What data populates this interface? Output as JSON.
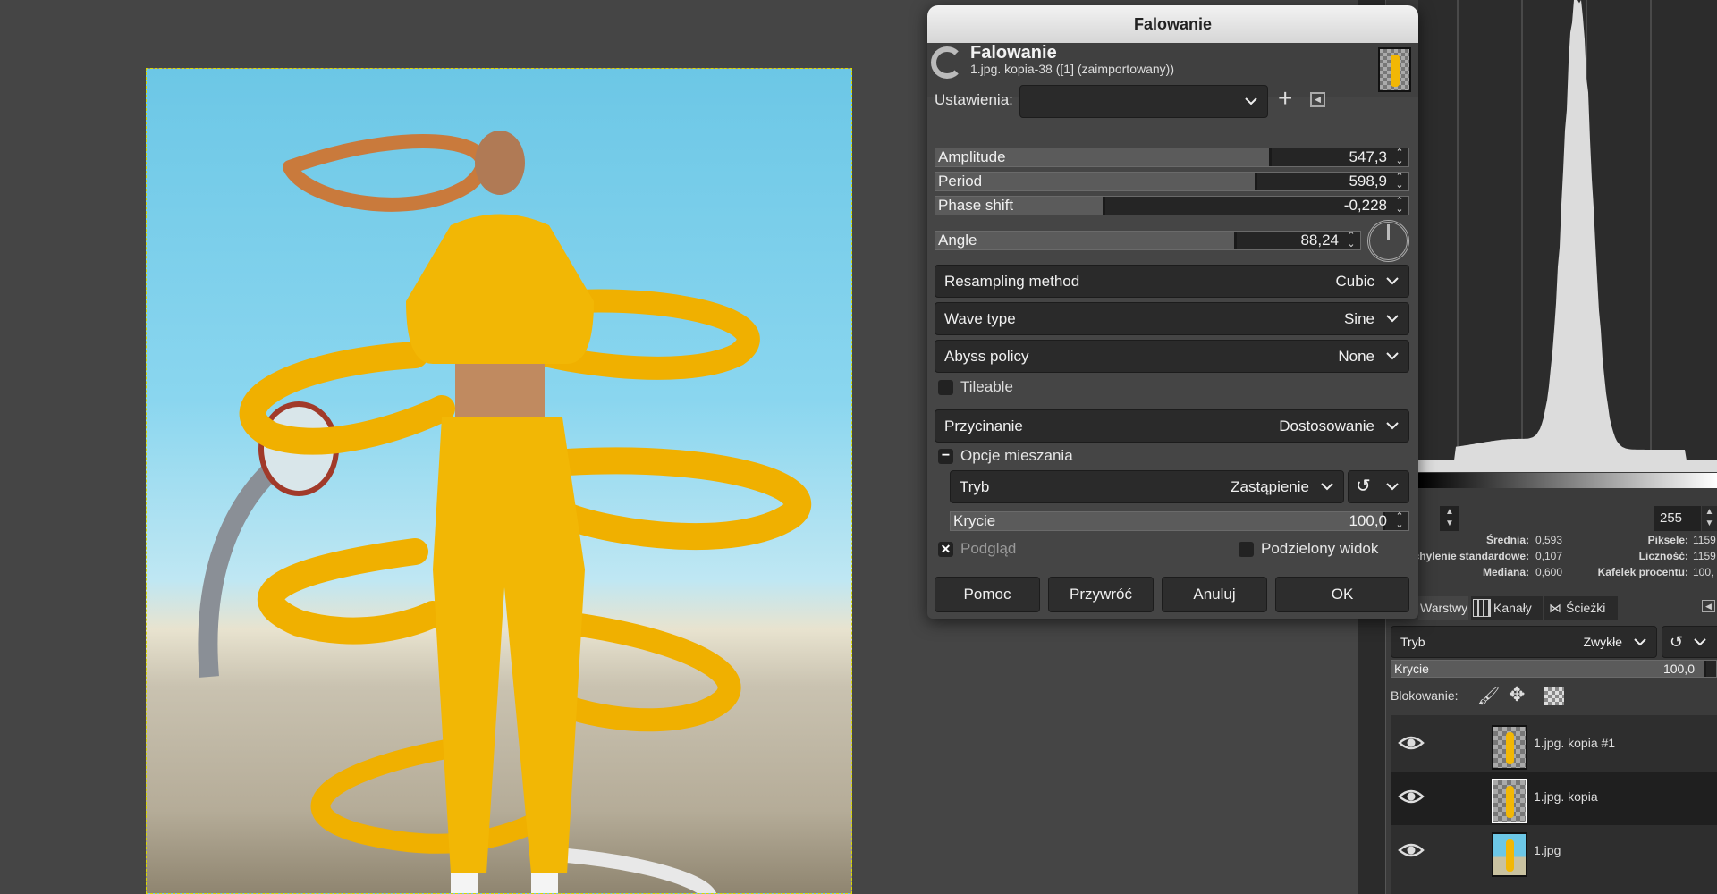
{
  "dialog": {
    "window_title": "Falowanie",
    "header_title": "Falowanie",
    "header_subtitle": "1.jpg. kopia-38 ([1] (zaimportowany))",
    "presets_label": "Ustawienia:",
    "presets_value": "",
    "sliders": [
      {
        "label": "Amplitude",
        "value": "547,3",
        "fill_fraction": 0.71
      },
      {
        "label": "Period",
        "value": "598,9",
        "fill_fraction": 0.68
      },
      {
        "label": "Phase shift",
        "value": "-0,228",
        "fill_fraction": 0.36
      },
      {
        "label": "Angle",
        "value": "88,24",
        "fill_fraction": 0.71
      }
    ],
    "resampling": {
      "label": "Resampling method",
      "value": "Cubic"
    },
    "wave_type": {
      "label": "Wave type",
      "value": "Sine"
    },
    "abyss": {
      "label": "Abyss policy",
      "value": "None"
    },
    "tileable": {
      "label": "Tileable",
      "checked": false
    },
    "clipping": {
      "label": "Przycinanie",
      "value": "Dostosowanie"
    },
    "blending": {
      "section_label": "Opcje mieszania",
      "mode_label": "Tryb",
      "mode_value": "Zastąpienie",
      "opacity_label": "Krycie",
      "opacity_value": "100,0"
    },
    "preview": {
      "label": "Podgląd",
      "checked": true
    },
    "split_view": {
      "label": "Podzielony widok",
      "checked": false
    },
    "buttons": {
      "help": "Pomoc",
      "reset": "Przywróć",
      "cancel": "Anuluj",
      "ok": "OK"
    }
  },
  "histogram": {
    "range_high": "255",
    "stats_left": [
      {
        "label": "Średnia:",
        "value": "0,593"
      },
      {
        "label": "Odchylenie standardowe:",
        "value": "0,107"
      },
      {
        "label": "Mediana:",
        "value": "0,600"
      }
    ],
    "stats_right": [
      {
        "label": "Piksele:",
        "value": "1159"
      },
      {
        "label": "Liczność:",
        "value": "1159"
      },
      {
        "label": "Kafelek procentu:",
        "value": "100,"
      }
    ]
  },
  "layers_panel": {
    "tabs": [
      {
        "label": "Warstwy",
        "icon": "layers-icon"
      },
      {
        "label": "Kanały",
        "icon": "channels-icon"
      },
      {
        "label": "Ścieżki",
        "icon": "paths-icon"
      }
    ],
    "mode_label": "Tryb",
    "mode_value": "Zwykłe",
    "opacity_label": "Krycie",
    "opacity_value": "100,0",
    "lock_label": "Blokowanie:",
    "layers": [
      {
        "name": "1.jpg. kopia #1",
        "visible": true,
        "selected": false
      },
      {
        "name": "1.jpg. kopia",
        "visible": true,
        "selected": true
      },
      {
        "name": "1.jpg",
        "visible": true,
        "selected": false
      }
    ]
  },
  "colors": {
    "accent_yellow": "#f2b705",
    "sky": "#7fd0ec",
    "panel_bg": "#3b3b3b"
  }
}
